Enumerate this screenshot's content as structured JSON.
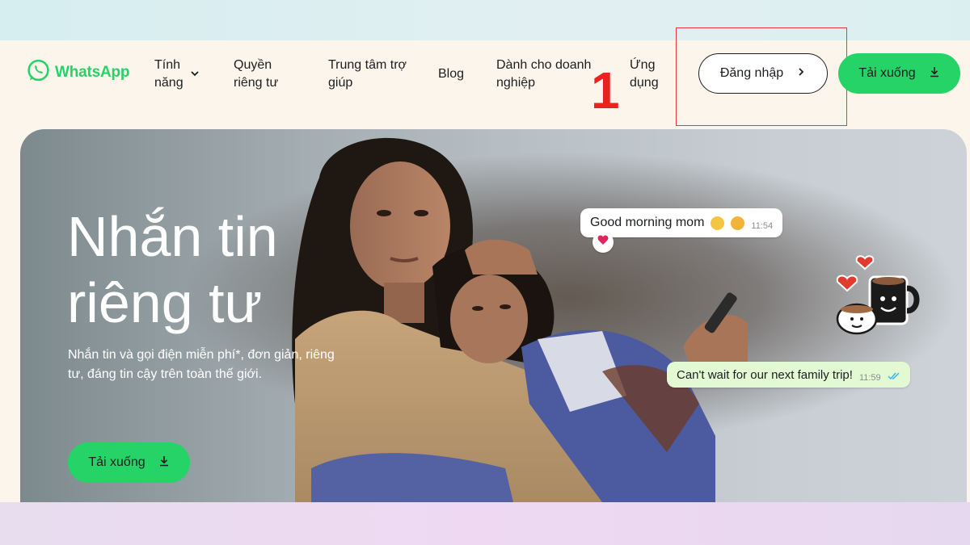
{
  "brand": {
    "name": "WhatsApp",
    "color": "#25d366"
  },
  "nav": {
    "features": "Tính năng",
    "privacy": "Quyền riêng tư",
    "help_center": "Trung tâm trợ giúp",
    "blog": "Blog",
    "business": "Dành cho doanh nghiệp",
    "apps": "Ứng dụng",
    "login": "Đăng nhập",
    "download": "Tải xuống"
  },
  "annotation": {
    "step": "1",
    "color": "#e82121"
  },
  "hero": {
    "title": "Nhắn tin riêng tư",
    "subtitle": "Nhắn tin và gọi điện miễn phí*, đơn giản, riêng tư, đáng tin cậy trên toàn thế giới.",
    "download": "Tải xuống"
  },
  "chat": {
    "message1": {
      "text": "Good morning mom",
      "time": "11:54",
      "reaction": "heart"
    },
    "message2": {
      "text": "Can't wait for our next family trip!",
      "time": "11:59",
      "status": "read-double-check"
    }
  },
  "icons": [
    "whatsapp-logo-icon",
    "chevron-down-icon",
    "chevron-right-icon",
    "download-icon",
    "heart-icon",
    "coffee-mug-sticker-icon",
    "double-check-icon"
  ]
}
